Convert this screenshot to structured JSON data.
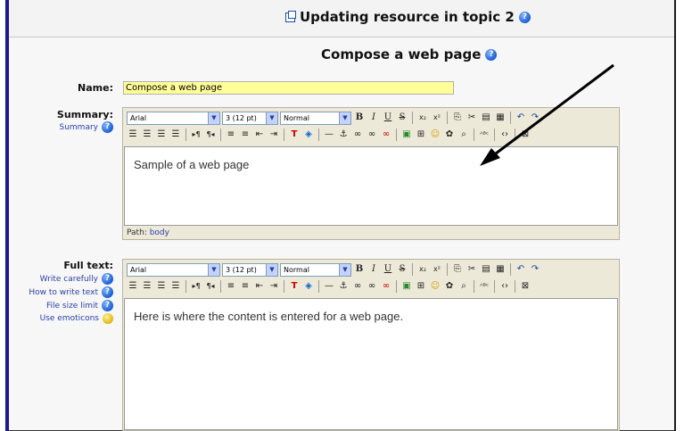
{
  "header": {
    "title": "Updating resource in topic 2"
  },
  "form": {
    "heading": "Compose a web page",
    "name_label": "Name:",
    "name_value": "Compose a web page",
    "summary_label": "Summary:",
    "summary_help": "Summary",
    "fulltext_label": "Full text:",
    "fulltext_help": [
      {
        "label": "Write carefully",
        "icon": "help-icon"
      },
      {
        "label": "How to write text",
        "icon": "help-icon"
      },
      {
        "label": "File size limit",
        "icon": "help-icon"
      },
      {
        "label": "Use emoticons",
        "icon": "emoticon-icon"
      }
    ]
  },
  "editor_summary": {
    "font": "Arial",
    "size": "3 (12 pt)",
    "format": "Normal",
    "content": "Sample of a web page",
    "path_label": "Path:",
    "path_value": "body"
  },
  "editor_fulltext": {
    "font": "Arial",
    "size": "3 (12 pt)",
    "format": "Normal",
    "content": "Here is where the content is entered for a web page."
  },
  "toolbar_row1_icons": [
    "bold-icon",
    "italic-icon",
    "underline-icon",
    "strikethrough-icon",
    "subscript-icon",
    "superscript-icon",
    "copy-icon",
    "cut-icon",
    "paste-icon",
    "paste-word-icon",
    "undo-icon",
    "redo-icon"
  ],
  "toolbar_row2_icons": [
    "align-left-icon",
    "align-center-icon",
    "align-right-icon",
    "justify-icon",
    "ltr-icon",
    "rtl-icon",
    "ordered-list-icon",
    "unordered-list-icon",
    "outdent-icon",
    "indent-icon",
    "text-color-icon",
    "bg-color-icon",
    "horizontal-rule-icon",
    "anchor-icon",
    "link-icon",
    "unlink-icon",
    "nolink-icon",
    "insert-image-icon",
    "insert-table-icon",
    "smiley-icon",
    "special-char-icon",
    "search-replace-icon",
    "spellcheck-icon",
    "html-source-icon",
    "fullscreen-icon"
  ],
  "colors": {
    "left_bar": "#1a1a8c",
    "name_field_bg": "#ffff99",
    "toolbar_bg": "#ece9d8",
    "help_link": "#2a3fa8"
  }
}
